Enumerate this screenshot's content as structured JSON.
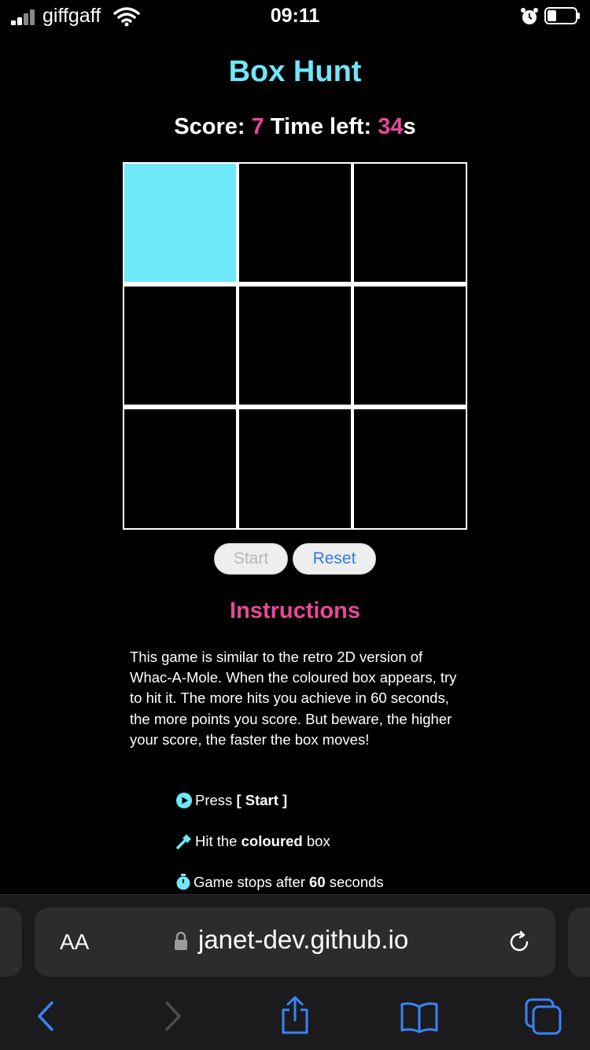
{
  "status_bar": {
    "carrier": "giffgaff",
    "time": "09:11",
    "icons": [
      "signal-icon",
      "wifi-icon",
      "alarm-icon",
      "battery-icon"
    ]
  },
  "game": {
    "title": "Box Hunt",
    "score_label": "Score:",
    "score_value": "7",
    "time_label": "Time left:",
    "time_value": "34",
    "time_unit": "s",
    "grid_rows": 3,
    "grid_cols": 3,
    "active_cell": 0,
    "start_label": "Start",
    "reset_label": "Reset"
  },
  "instructions": {
    "title": "Instructions",
    "paragraph": "This game is similar to the retro 2D version of Whac-A-Mole. When the coloured box appears, try to hit it. The more hits you achieve in 60 seconds, the more points you score. But beware, the higher your score, the faster the box moves!",
    "bullets": [
      {
        "icon": "play-icon",
        "pre": "Press ",
        "bold": "[ Start ]",
        "post": ""
      },
      {
        "icon": "hammer-icon",
        "pre": "Hit the ",
        "bold": "coloured",
        "post": " box"
      },
      {
        "icon": "stopwatch-icon",
        "pre": "Game stops after ",
        "bold": "60",
        "post": " seconds"
      }
    ]
  },
  "browser": {
    "text_size_label": "AA",
    "url": "janet-dev.github.io"
  },
  "colors": {
    "accent_cyan": "#6ee8f8",
    "accent_pink": "#e8489a",
    "link_blue": "#2f7bf0"
  }
}
